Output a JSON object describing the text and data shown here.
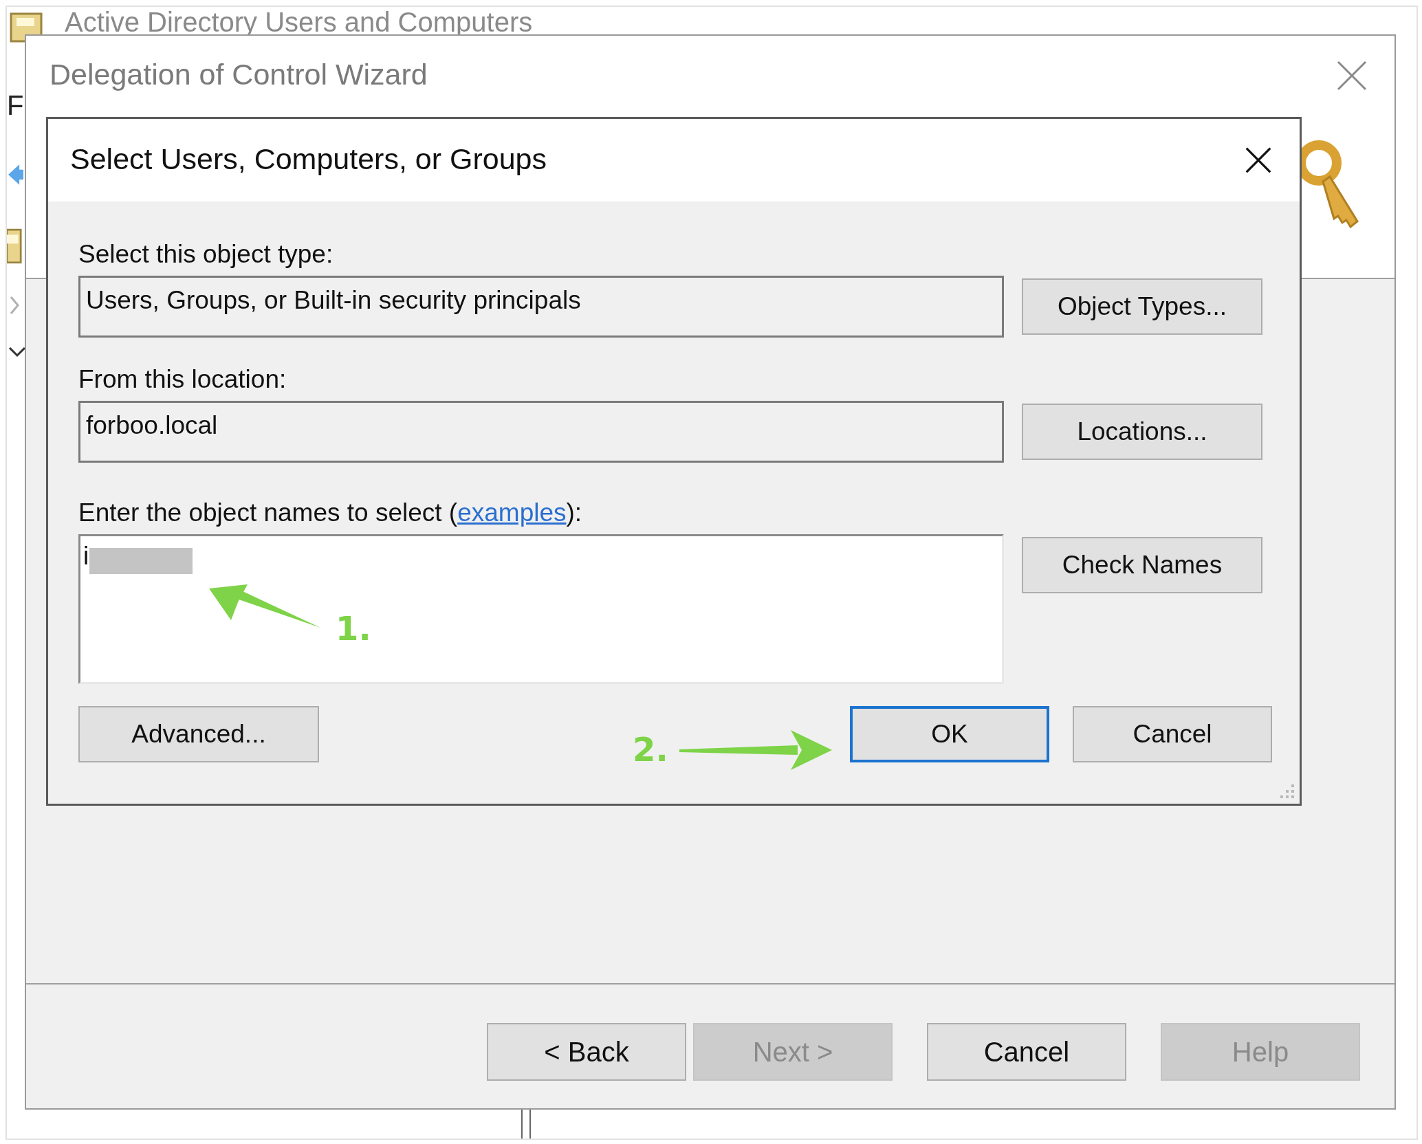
{
  "background_window": {
    "title": "Active Directory Users and Computers",
    "menu_letter": "F"
  },
  "wizard": {
    "title": "Delegation of Control Wizard",
    "buttons": [
      {
        "label": "< Back",
        "disabled": false
      },
      {
        "label": "Next >",
        "disabled": true
      },
      {
        "label": "Cancel",
        "disabled": false
      },
      {
        "label": "Help",
        "disabled": true
      }
    ]
  },
  "dialog": {
    "title": "Select Users, Computers, or Groups",
    "object_type": {
      "label": "Select this object type:",
      "value": "Users, Groups, or Built-in security principals",
      "button": "Object Types..."
    },
    "location": {
      "label": "From this location:",
      "value": "forboo.local",
      "button": "Locations..."
    },
    "names": {
      "label_start": "Enter the object names to select (",
      "link": "examples",
      "label_end": "):",
      "value": "i",
      "button": "Check Names"
    },
    "buttons": [
      {
        "label": "Advanced...",
        "default": false
      },
      {
        "label": "OK",
        "default": true
      },
      {
        "label": "Cancel",
        "default": false
      }
    ]
  },
  "annotations": [
    {
      "label": "1."
    },
    {
      "label": "2."
    }
  ]
}
